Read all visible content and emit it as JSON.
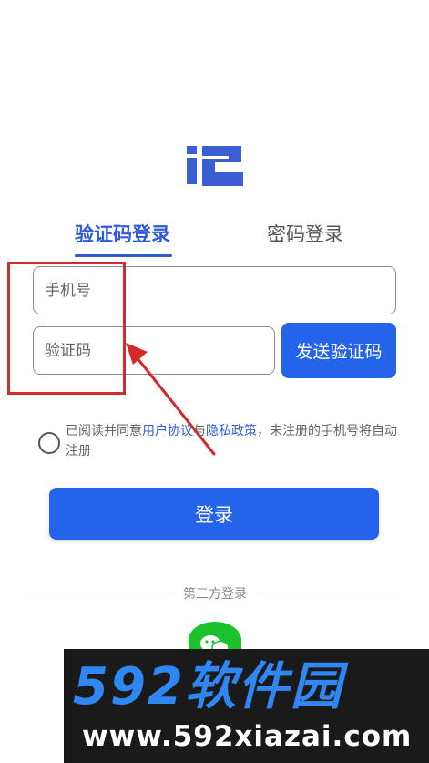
{
  "logo": {
    "glyph": "记",
    "color": "#3b5fd3"
  },
  "tabs": [
    {
      "label": "验证码登录",
      "active": true
    },
    {
      "label": "密码登录",
      "active": false
    }
  ],
  "form": {
    "phone_placeholder": "手机号",
    "code_placeholder": "验证码",
    "send_code_label": "发送验证码"
  },
  "agreement": {
    "prefix": "已阅读并同意",
    "user_agreement": "用户协议",
    "and": "与",
    "privacy_policy": "隐私政策",
    "suffix": "，未注册的手机号将自动注册",
    "checked": false
  },
  "login_button": "登录",
  "third_party": {
    "label": "第三方登录",
    "icons": [
      "wechat-icon"
    ]
  },
  "watermark": {
    "brand": "592软件园",
    "url": "www.592xiazai.com"
  },
  "colors": {
    "accent": "#2563eb",
    "link": "#2f5bd6",
    "annotation": "#d42a2a",
    "wechat": "#1dc12b"
  }
}
